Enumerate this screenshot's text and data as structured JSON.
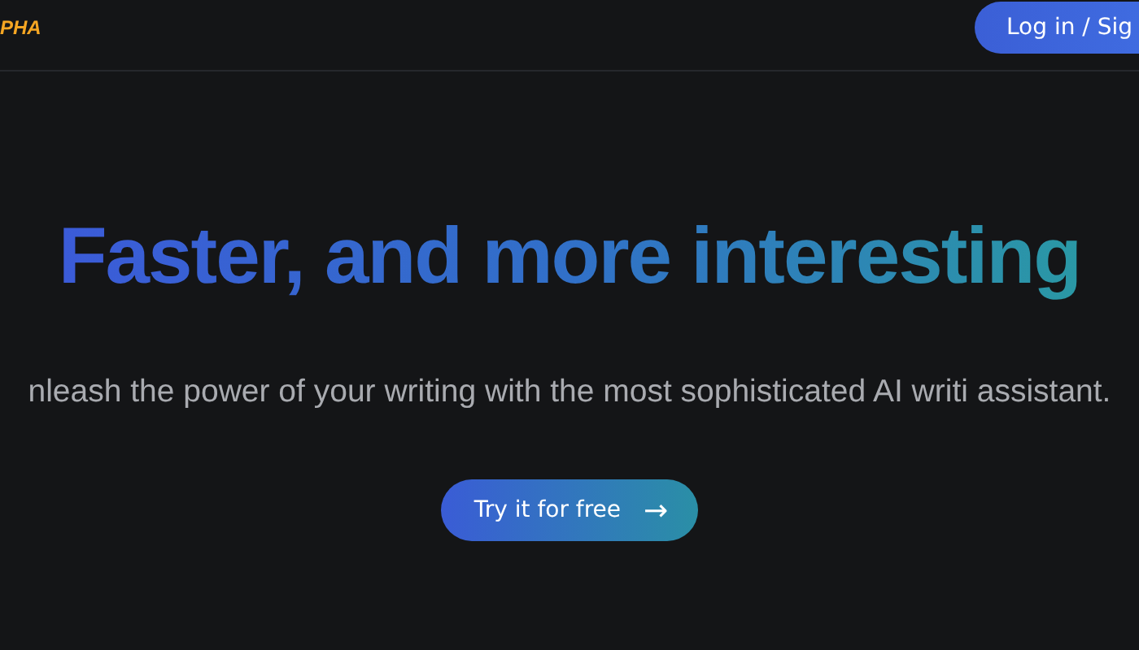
{
  "header": {
    "logo": "PHA",
    "login_button": "Log in / Sig"
  },
  "hero": {
    "heading": "Faster, and more interesting",
    "subtitle": "nleash the power of your writing with the most sophisticated AI writi assistant.",
    "cta_button": "Try it for free",
    "cta_icon": "→"
  }
}
